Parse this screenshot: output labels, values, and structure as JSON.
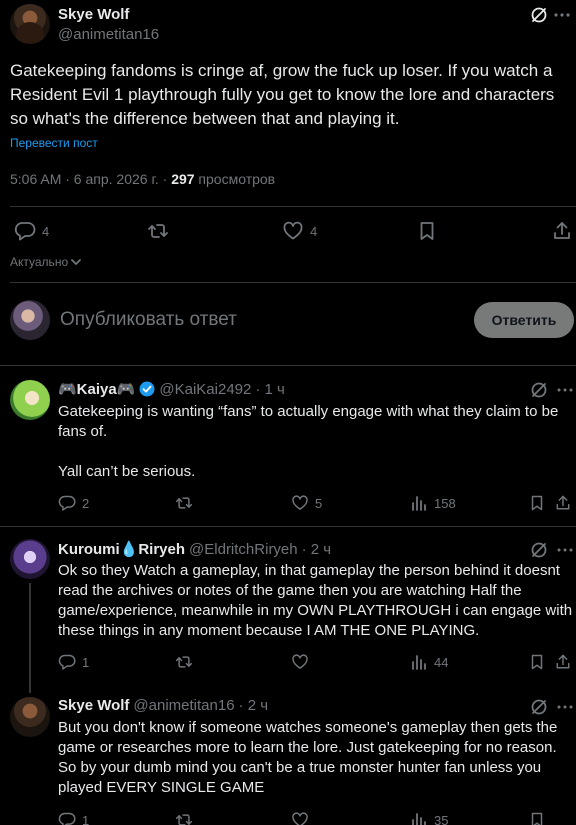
{
  "main_post": {
    "author_name": "Skye Wolf",
    "author_handle": "@animetitan16",
    "text": "Gatekeeping fandoms is cringe af, grow the fuck up loser. If you watch a Resident Evil 1 playthrough fully you get to know the lore and characters so what's the difference between that and playing it.",
    "translate_label": "Перевести пост",
    "timestamp": "5:06 AM · 6 апр. 2026 г. · ",
    "views_count": "297",
    "views_label": " просмотров",
    "reply_count": "4",
    "repost_count": "",
    "like_count": "4"
  },
  "sort": {
    "label": "Актуально"
  },
  "composer": {
    "placeholder": "Опубликовать ответ",
    "reply_button": "Ответить"
  },
  "replies": [
    {
      "author_name": "🎮Kaiya🎮",
      "author_handle": "@KaiKai2492",
      "time": "· 1 ч",
      "verified": true,
      "text": "Gatekeeping is wanting “fans” to actually engage with what they claim to be fans of.\n\nYall can’t be serious.",
      "reply_count": "2",
      "repost_count": "",
      "like_count": "5",
      "views_count": "158"
    },
    {
      "author_name": "Kuroumi💧Riryeh",
      "author_handle": "@EldritchRiryeh",
      "time": "· 2 ч",
      "verified": false,
      "text": "Ok so they Watch a gameplay, in that gameplay the person behind it doesnt read the archives or notes of the game then you are watching Half the game/experience, meanwhile in my OWN PLAYTHROUGH i can engage with these things in any moment because I AM THE ONE PLAYING.",
      "reply_count": "1",
      "repost_count": "",
      "like_count": "",
      "views_count": "44"
    },
    {
      "author_name": "Skye Wolf",
      "author_handle": "@animetitan16",
      "time": "· 2 ч",
      "verified": false,
      "text": "But you don't know if someone watches someone's gameplay then gets the game or researches more to learn the lore. Just gatekeeping for no reason. So by your dumb mind you can't be a true monster hunter fan unless you played EVERY SINGLE GAME",
      "reply_count": "1",
      "repost_count": "",
      "like_count": "",
      "views_count": "35"
    }
  ],
  "colors": {
    "background": "#000000",
    "text_primary": "#e7e9ea",
    "text_secondary": "#71767b",
    "link": "#1d9bf0",
    "divider": "#2f3336",
    "reply_button_bg": "#787a7a"
  },
  "icons": {
    "grok": "grok-icon",
    "more": "more-icon",
    "reply": "reply-icon",
    "repost": "repost-icon",
    "like": "heart-icon",
    "bookmark": "bookmark-icon",
    "share": "share-icon",
    "views": "views-icon",
    "verified": "verified-badge-icon",
    "chevron": "chevron-down-icon"
  }
}
